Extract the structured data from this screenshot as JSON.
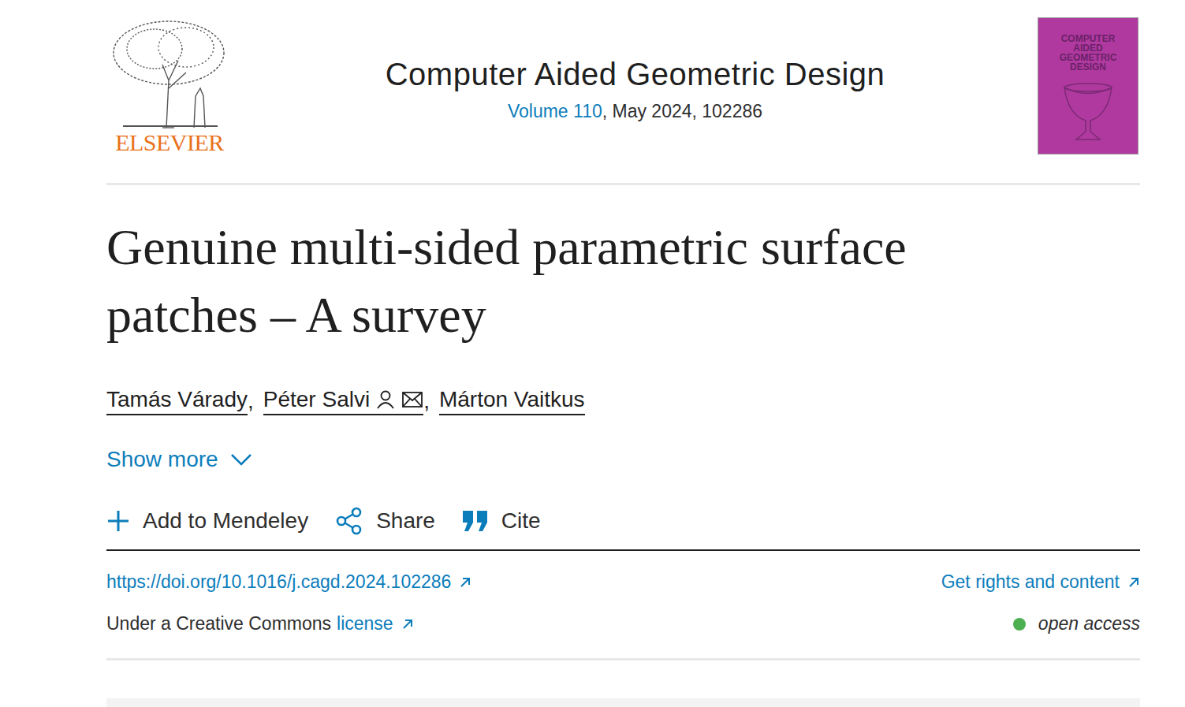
{
  "publisher": {
    "logo_text": "ELSEVIER"
  },
  "journal": {
    "title": "Computer Aided Geometric Design",
    "volume_link": "Volume 110",
    "issue_rest": ", May 2024, 102286",
    "cover_text": "COMPUTER AIDED GEOMETRIC DESIGN"
  },
  "article": {
    "title": "Genuine multi-sided parametric surface patches – A survey"
  },
  "authors": [
    {
      "name": "Tamás Várady",
      "corresponding": false,
      "separator": ","
    },
    {
      "name": "Péter Salvi",
      "corresponding": true,
      "separator": ","
    },
    {
      "name": "Márton Vaitkus",
      "corresponding": false,
      "separator": ""
    }
  ],
  "show_more": {
    "label": "Show more",
    "expanded": false
  },
  "actions": [
    {
      "label": "Add to Mendeley",
      "kind": "add"
    },
    {
      "label": "Share",
      "kind": "share"
    },
    {
      "label": "Cite",
      "kind": "cite"
    }
  ],
  "doi": "https://doi.org/10.1016/j.cagd.2024.102286",
  "rights": "Get rights and content",
  "license": {
    "prefix": "Under a Creative Commons",
    "link": "license"
  },
  "access": {
    "label": "open access",
    "open": true,
    "color": "#4caf50"
  }
}
